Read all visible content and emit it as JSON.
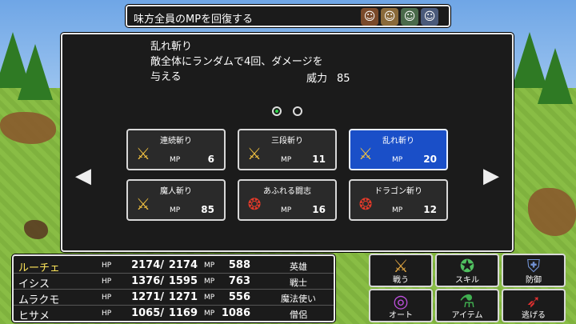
{
  "message": {
    "text": "味方全員のMPを回復する",
    "party_icons": [
      "hero-portrait-icon",
      "warrior-portrait-icon",
      "mage-portrait-icon",
      "priest-portrait-icon"
    ]
  },
  "skill_window": {
    "description_lines": [
      "乱れ斬り",
      "敵全体にランダムで4回、ダメージを",
      "与える"
    ],
    "power_label": "威力",
    "power_value": "85",
    "page_indicator": {
      "current": 1,
      "total": 2
    },
    "mp_label": "MP",
    "skills": [
      {
        "name": "連続斬り",
        "mp": "6",
        "icon": "sword-slash-icon",
        "selected": false
      },
      {
        "name": "三段斬り",
        "mp": "11",
        "icon": "sword-slash-icon",
        "selected": false
      },
      {
        "name": "乱れ斬り",
        "mp": "20",
        "icon": "sword-slash-icon",
        "selected": true
      },
      {
        "name": "魔人斬り",
        "mp": "85",
        "icon": "sword-slash-icon",
        "selected": false
      },
      {
        "name": "あふれる闘志",
        "mp": "16",
        "icon": "fighting-spirit-icon",
        "selected": false
      },
      {
        "name": "ドラゴン斬り",
        "mp": "12",
        "icon": "fighting-spirit-icon",
        "selected": false
      }
    ]
  },
  "party": {
    "hp_label": "HP",
    "mp_label": "MP",
    "members": [
      {
        "name": "ルーチェ",
        "hp": "2174/",
        "hp_max": "2174",
        "mp": "588",
        "job": "英雄",
        "active": true
      },
      {
        "name": "イシス",
        "hp": "1376/",
        "hp_max": "1595",
        "mp": "763",
        "job": "戦士",
        "active": false
      },
      {
        "name": "ムラクモ",
        "hp": "1271/",
        "hp_max": "1271",
        "mp": "556",
        "job": "魔法使い",
        "active": false
      },
      {
        "name": "ヒサメ",
        "hp": "1065/",
        "hp_max": "1169",
        "mp": "1086",
        "job": "僧侶",
        "active": false
      }
    ]
  },
  "commands": [
    {
      "label": "戦う",
      "icon": "sword-icon"
    },
    {
      "label": "スキル",
      "icon": "skill-icon"
    },
    {
      "label": "防御",
      "icon": "shield-icon"
    },
    {
      "label": "オート",
      "icon": "auto-icon"
    },
    {
      "label": "アイテム",
      "icon": "item-icon"
    },
    {
      "label": "逃げる",
      "icon": "run-icon"
    }
  ],
  "colors": {
    "panel_bg": "#1b1b1b",
    "selected_skill": "#1a4fc8",
    "active_member": "#ffe65a",
    "page_dot_active": "#2fd44a"
  }
}
